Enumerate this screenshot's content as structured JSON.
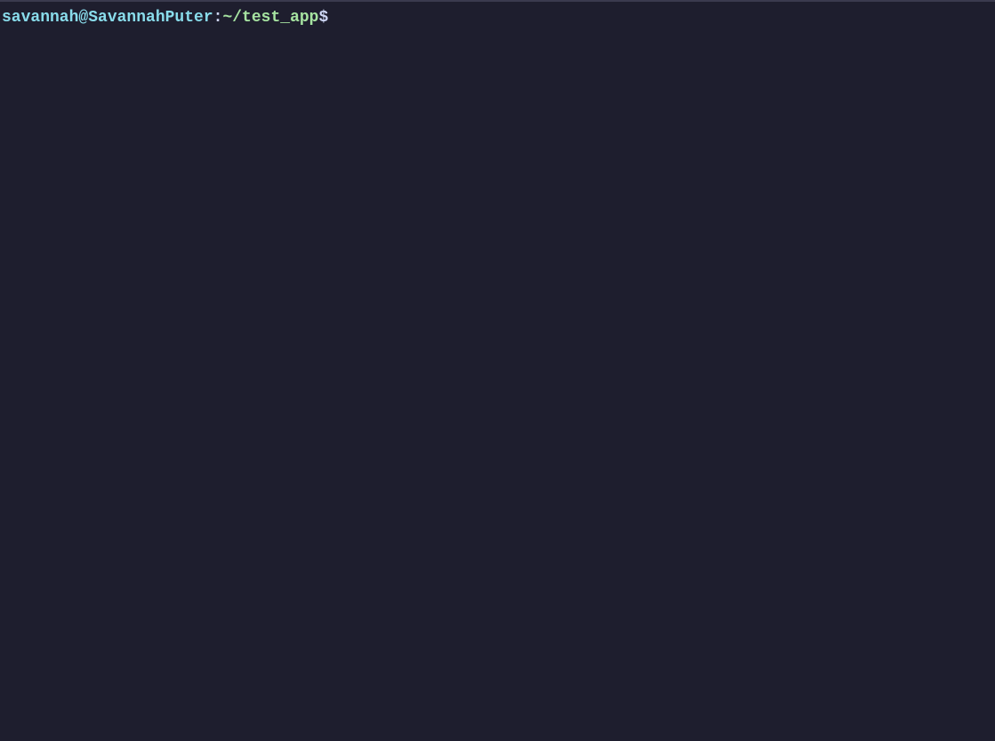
{
  "prompt": {
    "user_host": "savannah@SavannahPuter",
    "colon": ":",
    "path": "~/test_app",
    "symbol": "$",
    "input": ""
  }
}
